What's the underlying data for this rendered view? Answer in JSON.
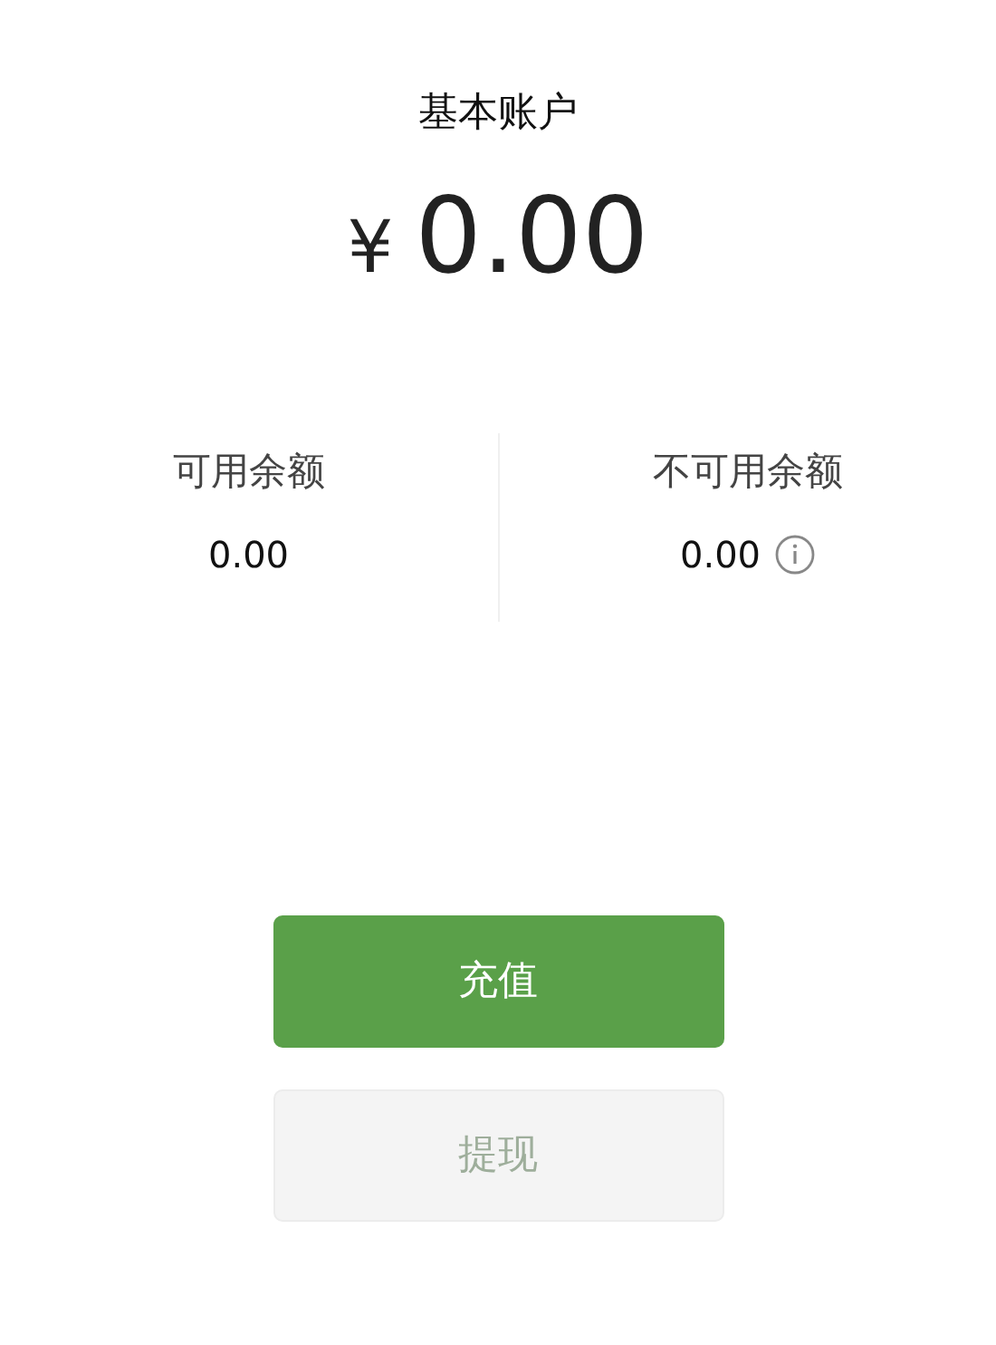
{
  "title": "基本账户",
  "balance": {
    "currency": "¥",
    "amount": "0.00"
  },
  "balances": [
    {
      "label": "可用余额",
      "value": "0.00",
      "info": false
    },
    {
      "label": "不可用余额",
      "value": "0.00",
      "info": true
    }
  ],
  "buttons": [
    {
      "label": "充值",
      "disabled": false
    },
    {
      "label": "提现",
      "disabled": true
    }
  ]
}
